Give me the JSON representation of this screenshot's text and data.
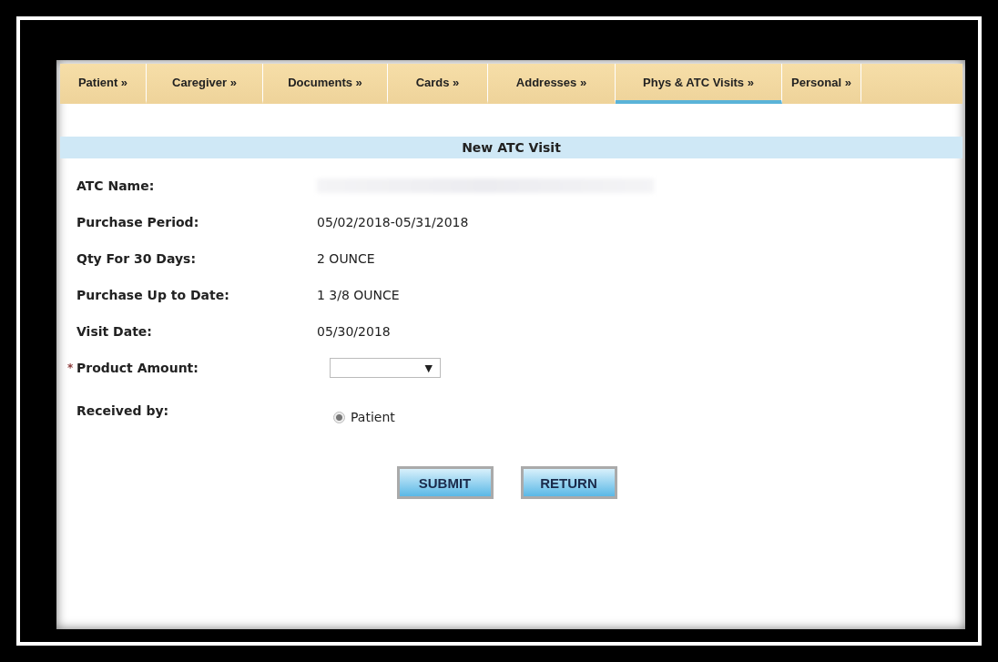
{
  "tabs": [
    {
      "label": "Patient »",
      "selected": false
    },
    {
      "label": "Caregiver »",
      "selected": false
    },
    {
      "label": "Documents »",
      "selected": false
    },
    {
      "label": "Cards »",
      "selected": false
    },
    {
      "label": "Addresses »",
      "selected": false
    },
    {
      "label": "Phys & ATC Visits »",
      "selected": true
    },
    {
      "label": "Personal »",
      "selected": false
    }
  ],
  "section_title": "New ATC Visit",
  "fields": [
    {
      "kind": "redacted",
      "label": "ATC Name:"
    },
    {
      "kind": "text",
      "label": "Purchase Period:",
      "value": "05/02/2018-05/31/2018"
    },
    {
      "kind": "text",
      "label": "Qty For 30 Days:",
      "value": "2 OUNCE"
    },
    {
      "kind": "text",
      "label": "Purchase Up to Date:",
      "value": "1 3/8 OUNCE"
    },
    {
      "kind": "text",
      "label": "Visit Date:",
      "value": "05/30/2018"
    },
    {
      "kind": "select",
      "label": "Product Amount:",
      "required": true,
      "required_mark": "*",
      "caret": "▼"
    },
    {
      "kind": "radio",
      "label": "Received by:",
      "options": [
        {
          "label": "Patient",
          "selected": true
        }
      ]
    }
  ],
  "buttons": [
    "SUBMIT",
    "RETURN"
  ]
}
